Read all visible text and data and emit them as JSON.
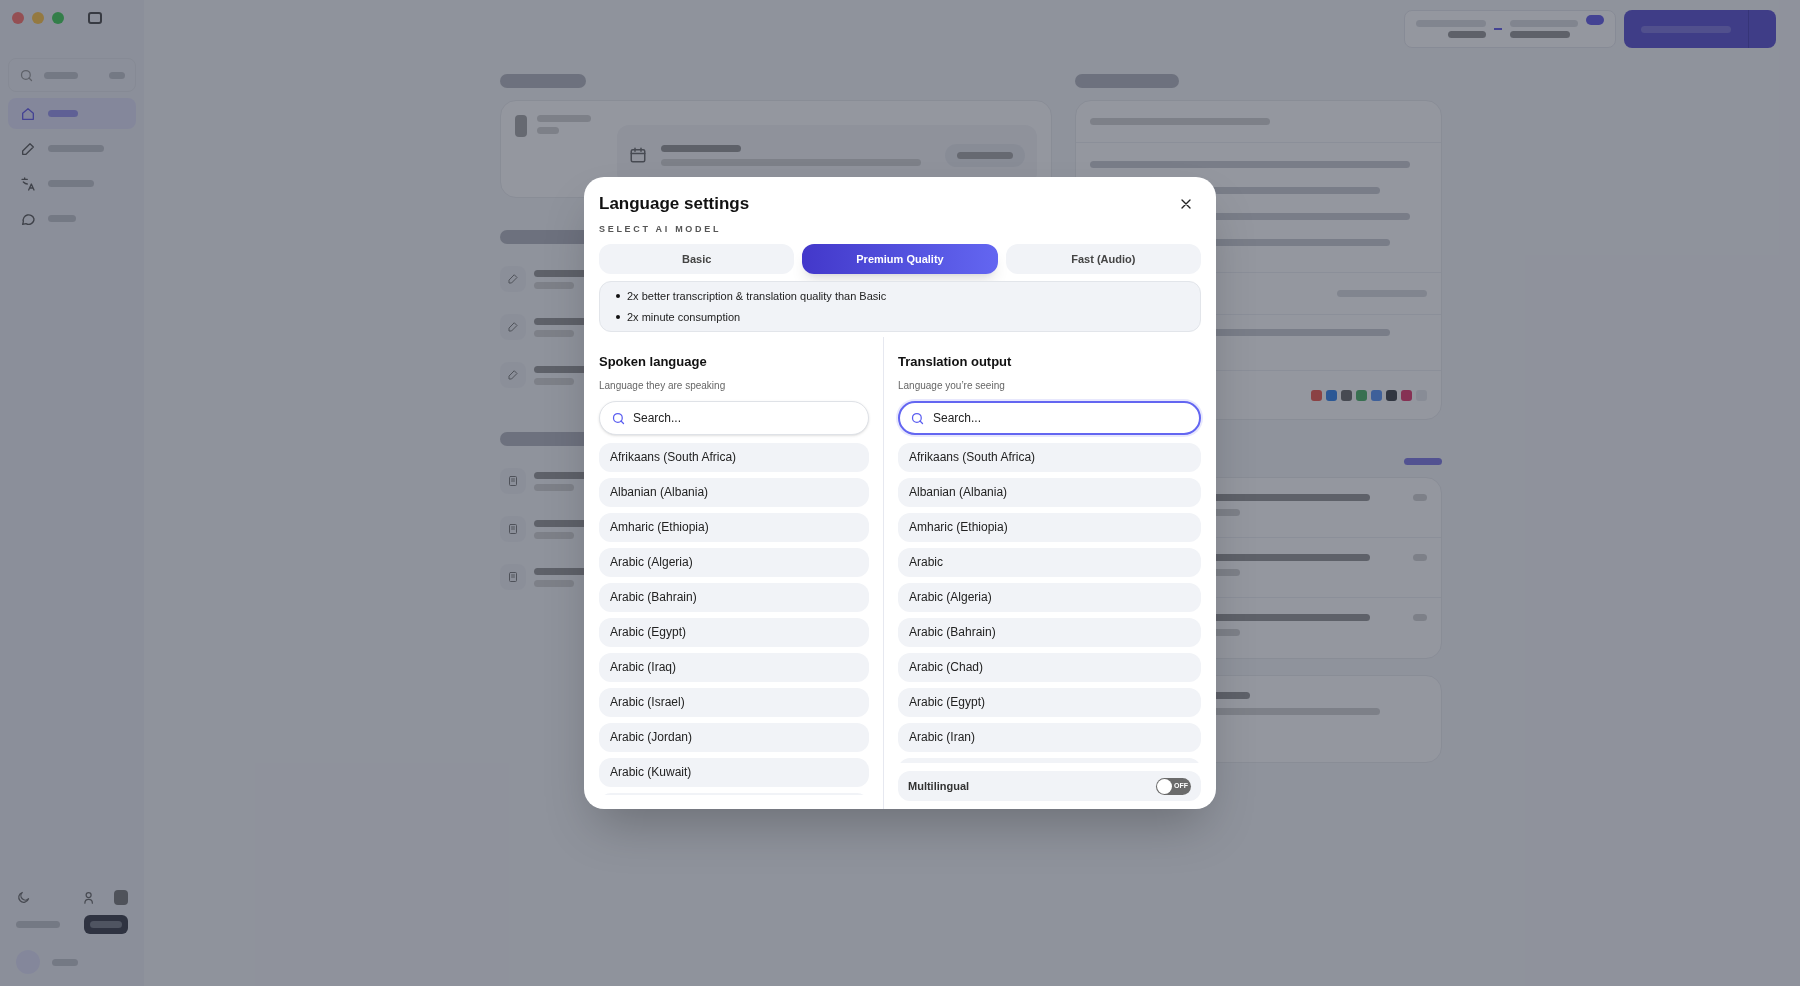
{
  "modal": {
    "title": "Language settings",
    "section_label": "SELECT AI MODEL",
    "models": [
      {
        "label": "Basic",
        "selected": false
      },
      {
        "label": "Premium Quality",
        "selected": true
      },
      {
        "label": "Fast (Audio)",
        "selected": false
      }
    ],
    "features": [
      "2x better transcription & translation quality than Basic",
      "2x minute consumption"
    ],
    "spoken": {
      "title": "Spoken language",
      "subtitle": "Language they are speaking",
      "search_placeholder": "Search...",
      "focused": false,
      "languages": [
        "Afrikaans (South Africa)",
        "Albanian (Albania)",
        "Amharic (Ethiopia)",
        "Arabic (Algeria)",
        "Arabic (Bahrain)",
        "Arabic (Egypt)",
        "Arabic (Iraq)",
        "Arabic (Israel)",
        "Arabic (Jordan)",
        "Arabic (Kuwait)"
      ]
    },
    "output": {
      "title": "Translation output",
      "subtitle": "Language you’re seeing",
      "search_placeholder": "Search...",
      "focused": true,
      "languages": [
        "Afrikaans (South Africa)",
        "Albanian (Albania)",
        "Amharic (Ethiopia)",
        "Arabic",
        "Arabic (Algeria)",
        "Arabic (Bahrain)",
        "Arabic (Chad)",
        "Arabic (Egypt)",
        "Arabic (Iran)"
      ]
    },
    "multilingual": {
      "label": "Multilingual",
      "on": false,
      "state_text": "OFF"
    }
  }
}
